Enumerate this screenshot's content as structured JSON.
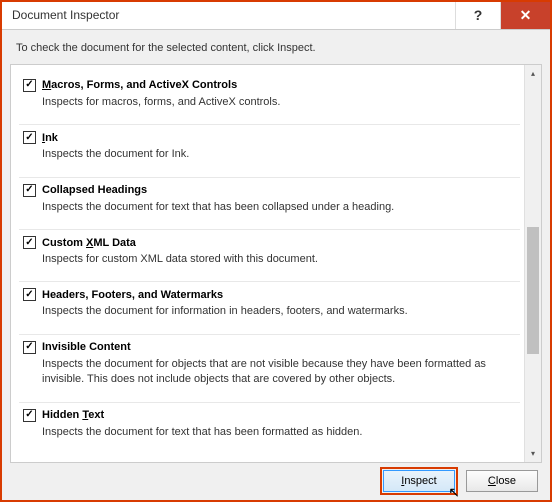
{
  "titlebar": {
    "title": "Document Inspector",
    "help": "?",
    "close": "✕"
  },
  "instruction": "To check the document for the selected content, click Inspect.",
  "items": [
    {
      "title_pre": "",
      "title_ul": "M",
      "title_post": "acros, Forms, and ActiveX Controls",
      "desc": "Inspects for macros, forms, and ActiveX controls."
    },
    {
      "title_pre": "",
      "title_ul": "I",
      "title_post": "nk",
      "desc": "Inspects the document for Ink."
    },
    {
      "title_pre": "Collapsed Headings",
      "title_ul": "",
      "title_post": "",
      "desc": "Inspects the document for text that has been collapsed under a heading."
    },
    {
      "title_pre": "Custom ",
      "title_ul": "X",
      "title_post": "ML Data",
      "desc": "Inspects for custom XML data stored with this document."
    },
    {
      "title_pre": "Headers, Footers, and Watermarks",
      "title_ul": "",
      "title_post": "",
      "desc": "Inspects the document for information in headers, footers, and watermarks."
    },
    {
      "title_pre": "Invisible Content",
      "title_ul": "",
      "title_post": "",
      "desc": "Inspects the document for objects that are not visible because they have been formatted as invisible. This does not include objects that are covered by other objects."
    },
    {
      "title_pre": "Hidden ",
      "title_ul": "T",
      "title_post": "ext",
      "desc": "Inspects the document for text that has been formatted as hidden."
    }
  ],
  "footer": {
    "inspect_ul": "I",
    "inspect_post": "nspect",
    "close_ul": "C",
    "close_post": "lose"
  }
}
